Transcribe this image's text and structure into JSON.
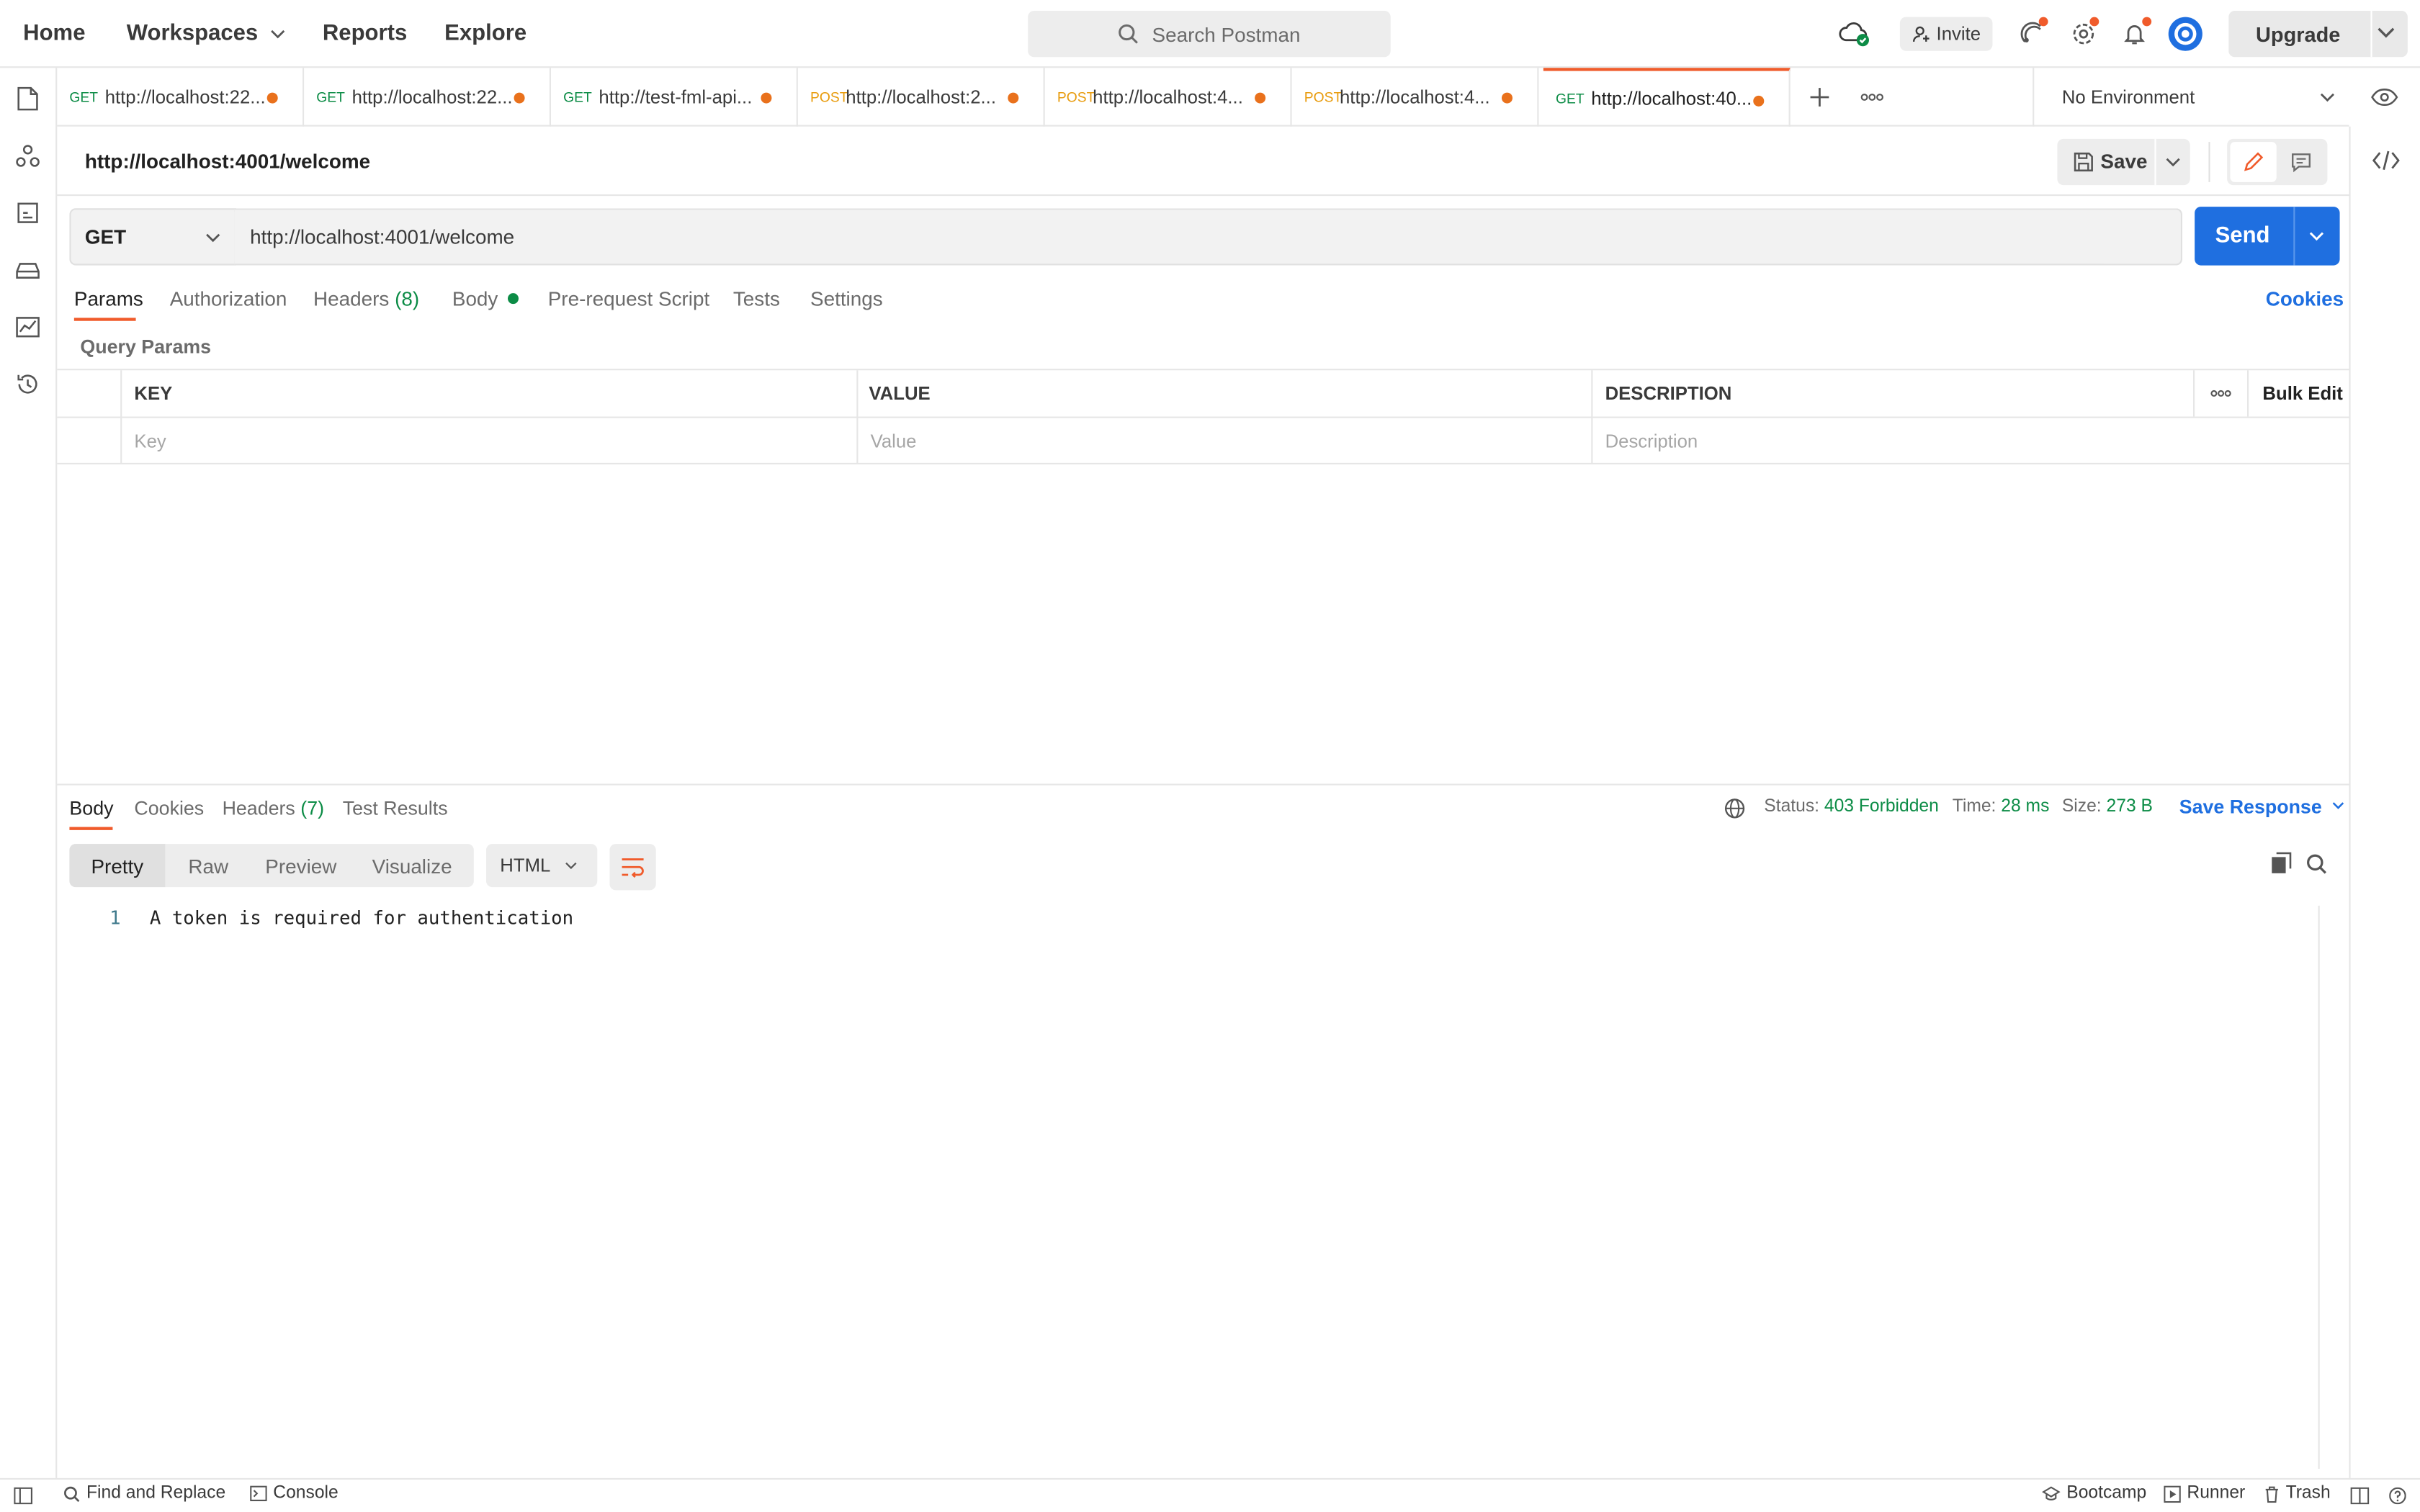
{
  "topbar": {
    "nav": [
      "Home",
      "Workspaces",
      "Reports",
      "Explore"
    ],
    "search_placeholder": "Search Postman",
    "invite_label": "Invite",
    "upgrade_label": "Upgrade"
  },
  "tabs": [
    {
      "method": "GET",
      "url": "http://localhost:22...",
      "method_color": "#0c8c46"
    },
    {
      "method": "GET",
      "url": "http://localhost:22...",
      "method_color": "#0c8c46"
    },
    {
      "method": "GET",
      "url": "http://test-fml-api...",
      "method_color": "#0c8c46"
    },
    {
      "method": "POST",
      "url": "http://localhost:2...",
      "method_color": "#e89b0c"
    },
    {
      "method": "POST",
      "url": "http://localhost:4...",
      "method_color": "#e89b0c"
    },
    {
      "method": "POST",
      "url": "http://localhost:4...",
      "method_color": "#e89b0c"
    },
    {
      "method": "GET",
      "url": "http://localhost:40...",
      "method_color": "#0c8c46"
    }
  ],
  "environment": "No Environment",
  "request": {
    "name": "http://localhost:4001/welcome",
    "save_label": "Save",
    "method": "GET",
    "url": "http://localhost:4001/welcome",
    "send_label": "Send",
    "tabs": {
      "params": "Params",
      "authorization": "Authorization",
      "headers": "Headers",
      "headers_count": "(8)",
      "body": "Body",
      "prerequest": "Pre-request Script",
      "tests": "Tests",
      "settings": "Settings"
    },
    "cookies_label": "Cookies",
    "query_params_title": "Query Params",
    "columns": {
      "key": "KEY",
      "value": "VALUE",
      "description": "DESCRIPTION",
      "bulk_edit": "Bulk Edit"
    },
    "placeholders": {
      "key": "Key",
      "value": "Value",
      "description": "Description"
    }
  },
  "response": {
    "tabs": {
      "body": "Body",
      "cookies": "Cookies",
      "headers": "Headers",
      "headers_count": "(7)",
      "test_results": "Test Results"
    },
    "status_label": "Status:",
    "status_value": "403 Forbidden",
    "time_label": "Time:",
    "time_value": "28 ms",
    "size_label": "Size:",
    "size_value": "273 B",
    "save_response_label": "Save Response",
    "views": [
      "Pretty",
      "Raw",
      "Preview",
      "Visualize"
    ],
    "format": "HTML",
    "line_number": "1",
    "body_text": "A token is required for authentication"
  },
  "footer": {
    "find_replace": "Find and Replace",
    "console": "Console",
    "bootcamp": "Bootcamp",
    "runner": "Runner",
    "trash": "Trash"
  },
  "colors": {
    "accent": "#f05b2b",
    "primary": "#1f6fe0",
    "success": "#0c8c46",
    "post": "#e89b0c"
  }
}
